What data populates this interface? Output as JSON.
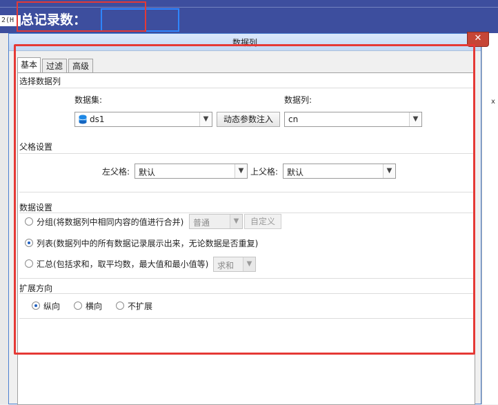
{
  "background": {
    "total_records_label": "总记录数：",
    "row_header": "2(H",
    "right_marker": "x"
  },
  "dialog": {
    "title": "数据列",
    "close_symbol": "✕",
    "tabs": [
      {
        "label": "基本",
        "active": true
      },
      {
        "label": "过滤",
        "active": false
      },
      {
        "label": "高级",
        "active": false
      }
    ]
  },
  "select_column": {
    "section_title": "选择数据列",
    "dataset_label": "数据集:",
    "dataset_value": "ds1",
    "dataset_icon": "database-icon",
    "dynamic_param_button": "动态参数注入",
    "column_label": "数据列:",
    "column_value": "cn"
  },
  "parent_settings": {
    "section_title": "父格设置",
    "left_parent_label": "左父格:",
    "left_parent_value": "默认",
    "top_parent_label": "上父格:",
    "top_parent_value": "默认"
  },
  "data_settings": {
    "section_title": "数据设置",
    "options": [
      {
        "label": "分组(将数据列中相同内容的值进行合并)",
        "checked": false
      },
      {
        "label": "列表(数据列中的所有数据记录展示出来，无论数据是否重复)",
        "checked": true
      },
      {
        "label": "汇总(包括求和，取平均数，最大值和最小值等)",
        "checked": false
      }
    ],
    "group_mode_value": "普通",
    "custom_button": "自定义",
    "summary_mode_value": "求和"
  },
  "expand_direction": {
    "section_title": "扩展方向",
    "options": [
      {
        "label": "纵向",
        "checked": true
      },
      {
        "label": "横向",
        "checked": false
      },
      {
        "label": "不扩展",
        "checked": false
      }
    ]
  },
  "colors": {
    "header_bg": "#3d4e9e",
    "annotation_red": "#e53935",
    "selection_blue": "#2f86ff"
  }
}
